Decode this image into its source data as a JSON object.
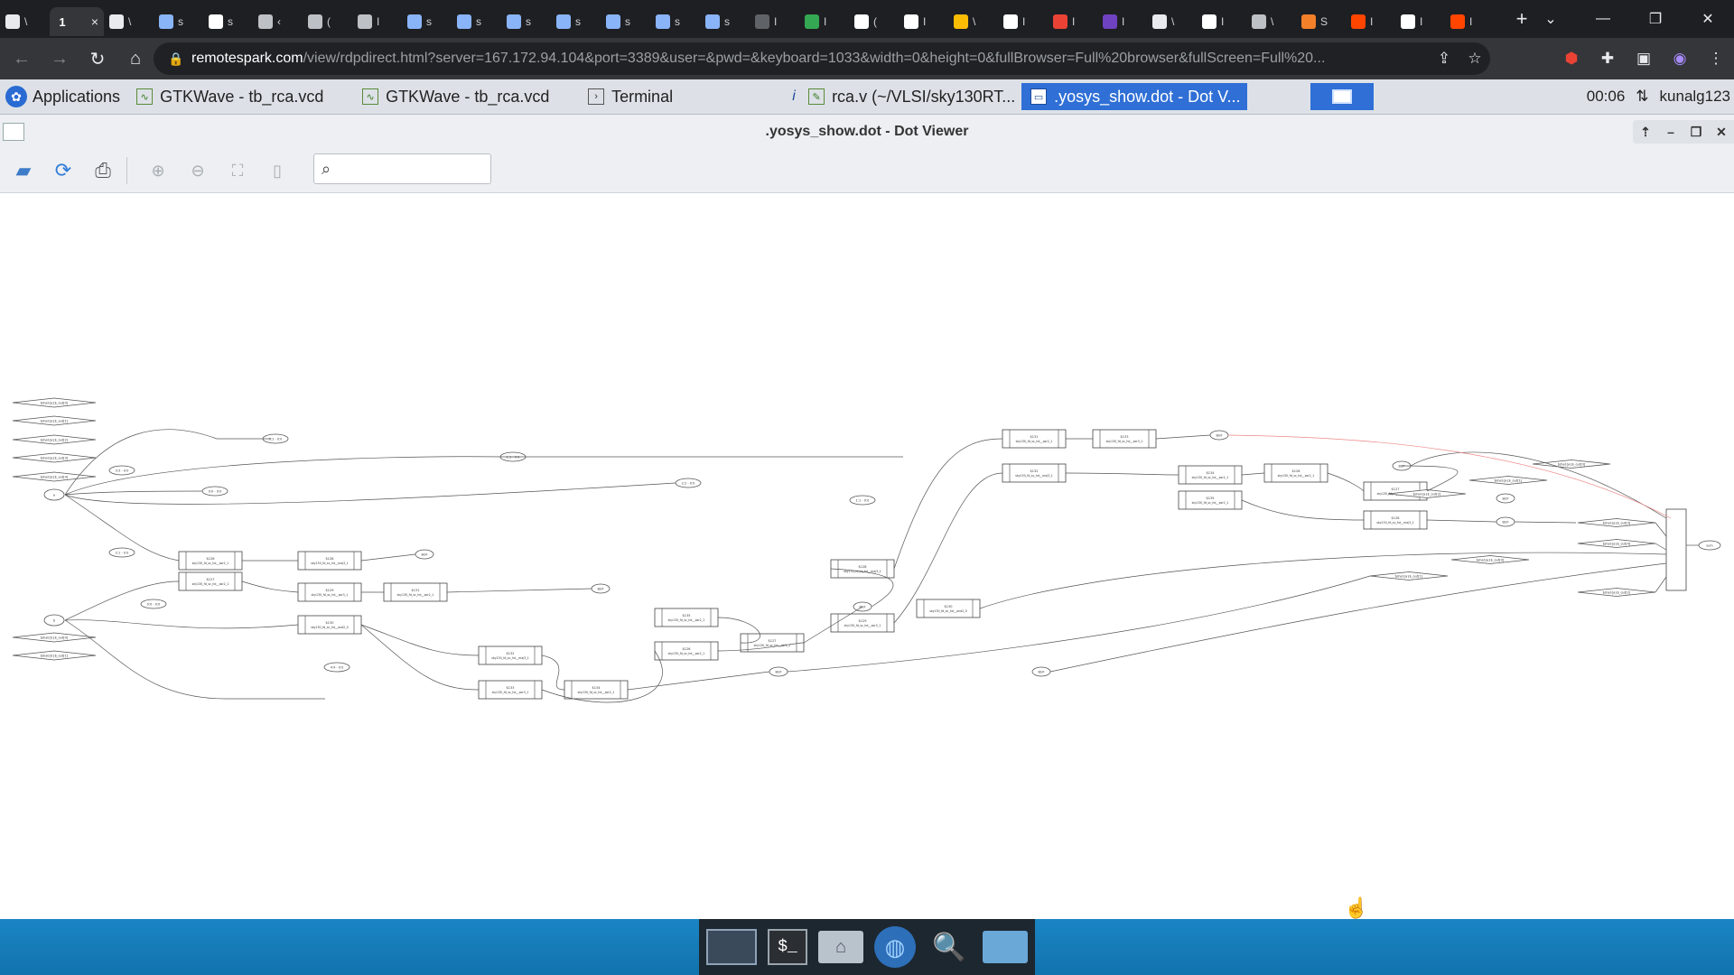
{
  "browser": {
    "tabs": [
      {
        "icon": "document-icon",
        "label": "\\",
        "color": "#e8eaed"
      },
      {
        "icon": "tab-number",
        "label": "1",
        "active": true,
        "close": "×"
      },
      {
        "icon": "document-icon",
        "label": "\\",
        "color": "#e8eaed"
      },
      {
        "icon": "document-icon",
        "label": "s",
        "color": "#8ab4f8"
      },
      {
        "icon": "google-icon",
        "label": "s",
        "color": "#ffffff"
      },
      {
        "icon": "web-icon",
        "label": "‹",
        "color": "#bdc1c6"
      },
      {
        "icon": "web-icon",
        "label": "(",
        "color": "#bdc1c6"
      },
      {
        "icon": "web-icon",
        "label": "I",
        "color": "#bdc1c6"
      },
      {
        "icon": "document-icon",
        "label": "s",
        "color": "#8ab4f8"
      },
      {
        "icon": "document-icon",
        "label": "s",
        "color": "#8ab4f8"
      },
      {
        "icon": "document-icon",
        "label": "s",
        "color": "#8ab4f8"
      },
      {
        "icon": "document-icon",
        "label": "s",
        "color": "#8ab4f8"
      },
      {
        "icon": "document-icon",
        "label": "s",
        "color": "#8ab4f8"
      },
      {
        "icon": "document-icon",
        "label": "s",
        "color": "#8ab4f8"
      },
      {
        "icon": "document-icon",
        "label": "s",
        "color": "#8ab4f8"
      },
      {
        "icon": "circle-icon",
        "label": "I",
        "color": "#5f6368"
      },
      {
        "icon": "wave-icon",
        "label": "I",
        "color": "#34a853"
      },
      {
        "icon": "github-icon",
        "label": "(",
        "color": "#ffffff"
      },
      {
        "icon": "github-icon",
        "label": "I",
        "color": "#ffffff"
      },
      {
        "icon": "slides-icon",
        "label": "\\",
        "color": "#fbbc04"
      },
      {
        "icon": "google-icon",
        "label": "I",
        "color": "#ffffff"
      },
      {
        "icon": "pdf-icon",
        "label": "I",
        "color": "#ea4335"
      },
      {
        "icon": "w-icon",
        "label": "I",
        "color": "#6f42c1"
      },
      {
        "icon": "document-icon",
        "label": "\\",
        "color": "#e8eaed"
      },
      {
        "icon": "google-icon",
        "label": "I",
        "color": "#ffffff"
      },
      {
        "icon": "web-icon",
        "label": "\\",
        "color": "#bdc1c6"
      },
      {
        "icon": "flame-icon",
        "label": "S",
        "color": "#f4802a"
      },
      {
        "icon": "reddit-icon",
        "label": "I",
        "color": "#ff4500"
      },
      {
        "icon": "google-icon",
        "label": "I",
        "color": "#ffffff"
      },
      {
        "icon": "reddit-icon",
        "label": "I",
        "color": "#ff4500"
      }
    ],
    "new_tab": "+",
    "url_host": "remotespark.com",
    "url_path": "/view/rdpdirect.html?server=167.172.94.104&port=3389&user=&pwd=&keyboard=1033&width=0&height=0&fullBrowser=Full%20browser&fullScreen=Full%20..."
  },
  "desktop_panel": {
    "apps_label": "Applications",
    "tasks": [
      {
        "label": "GTKWave - tb_rca.vcd",
        "icon": "gtkwave-icon"
      },
      {
        "label": "GTKWave - tb_rca.vcd",
        "icon": "gtkwave-icon"
      },
      {
        "label": "Terminal",
        "icon": "terminal-icon"
      },
      {
        "label": "rca.v (~/VLSI/sky130RT...",
        "icon": "editor-icon"
      },
      {
        "label": ".yosys_show.dot - Dot V...",
        "icon": "dot-viewer-icon",
        "active": true
      }
    ],
    "clock": "00:06",
    "user": "kunalg123"
  },
  "window": {
    "title": ".yosys_show.dot - Dot Viewer",
    "search_placeholder": ""
  },
  "graph": {
    "inputs_top": [
      "$\\hat{a}$_out[0]",
      "$\\hat{a}$_out[1]",
      "$\\hat{a}$_out[2]",
      "$\\hat{a}$_out[3]",
      "$\\hat{a}$_out[4]"
    ],
    "inputs_bottom": [
      "$\\hat{b}$_out[0]",
      "$\\hat{b}$_out[1]"
    ],
    "splitters": [
      "3:1 - 0:0",
      "1:1 - 0:0",
      "0:0 - 0:0",
      "2:2 - 0:0",
      "1:1 - 0:0",
      "3:3 - 0:0",
      "2:1 - 0:0",
      "0:0 - 0:0",
      "4:4 - 0:0"
    ],
    "cells": [
      {
        "id": "$126",
        "type": "sky130_fd_sc_hd__xor2_1"
      },
      {
        "id": "$127",
        "type": "sky130_fd_sc_hd__xor2_1"
      },
      {
        "id": "$128",
        "type": "sky130_fd_sc_hd__maj3_1"
      },
      {
        "id": "$129",
        "type": "sky130_fd_sc_hd__xor3_1"
      },
      {
        "id": "$130",
        "type": "sky130_fd_sc_hd__and2_0"
      },
      {
        "id": "$131",
        "type": "sky130_fd_sc_hd__xor2_1"
      },
      {
        "id": "$132",
        "type": "sky130_fd_sc_hd__maj3_1"
      },
      {
        "id": "$133",
        "type": "sky130_fd_sc_hd__xor3_1"
      },
      {
        "id": "$134",
        "type": "sky130_fd_sc_hd__xor2_1"
      },
      {
        "id": "$135",
        "type": "sky130_fd_sc_hd__xor2_1"
      }
    ],
    "buf_label": "BUF",
    "output_label": "sum"
  },
  "dock": {
    "items": [
      "screen-icon",
      "terminal-icon",
      "home-folder-icon",
      "web-browser-icon",
      "search-icon",
      "folder-icon"
    ],
    "terminal_glyph": "$_"
  }
}
